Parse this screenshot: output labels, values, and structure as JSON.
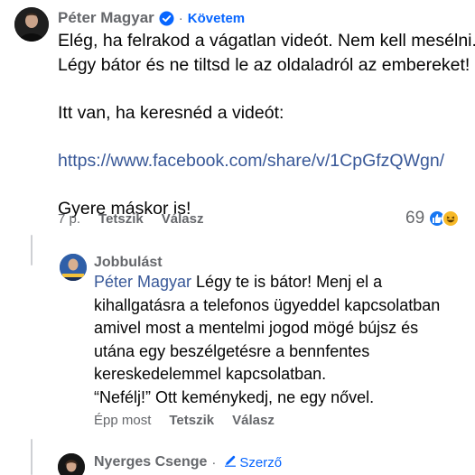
{
  "comment1": {
    "author": "Péter Magyar",
    "follow_label": "Követem",
    "lines": [
      "Elég, ha felrakod a vágatlan videót. Nem kell mesélni.",
      "Légy bátor és ne tiltsd le az oldaladról az embereket!",
      "",
      "Itt van, ha keresnéd a videót:",
      "",
      "https://www.facebook.com/share/v/1CpGfzQWgn/",
      "",
      "Gyere máskor is!"
    ],
    "time": "7 p.",
    "like_label": "Tetszik",
    "reply_label": "Válasz",
    "reaction_count": "69",
    "reaction_icons": [
      "like-icon",
      "haha-icon"
    ],
    "colors": {
      "like": "#1877f2",
      "haha": "#f7b928",
      "link": "#385898"
    }
  },
  "reply": {
    "author": "Jobbulást",
    "mention": "Péter Magyar",
    "lines": [
      " Légy te is bátor! Menj el a",
      "kihallgatásra a telefonos ügyeddel kapcsolatban",
      "amivel most a mentelmi jogod mögé bújsz és",
      "utána egy beszélgetésre a bennfentes",
      "kereskedelemmel kapcsolatban.",
      "“Nefélj!” Ott keménykedj, ne egy nővel."
    ],
    "time": "Épp most",
    "like_label": "Tetszik",
    "reply_label": "Válasz"
  },
  "comment3": {
    "author": "Nyerges Csenge",
    "badge_label": "Szerző"
  }
}
